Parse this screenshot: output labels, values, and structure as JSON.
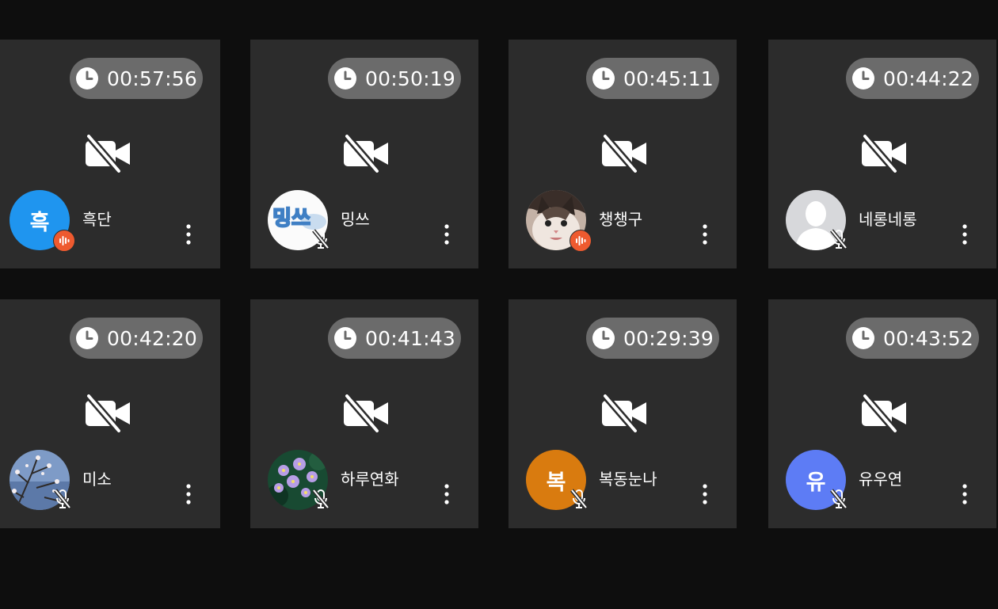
{
  "participants": [
    {
      "duration": "00:57:56",
      "name": "흑단",
      "avatar_type": "letter",
      "avatar_text": "흑",
      "avatar_color": "#1f95ef",
      "mic": "speaking"
    },
    {
      "duration": "00:50:19",
      "name": "밍쓰",
      "avatar_type": "image",
      "avatar_image": "handwritten-logo",
      "avatar_text": "밍쓰",
      "mic": "muted"
    },
    {
      "duration": "00:45:11",
      "name": "챙챙구",
      "avatar_type": "image",
      "avatar_image": "cat-photo",
      "mic": "speaking"
    },
    {
      "duration": "00:44:22",
      "name": "네롱네롱",
      "avatar_type": "image",
      "avatar_image": "default-person-silhouette",
      "mic": "muted"
    },
    {
      "duration": "00:42:20",
      "name": "미소",
      "avatar_type": "image",
      "avatar_image": "blossom-branches-photo",
      "mic": "muted"
    },
    {
      "duration": "00:41:43",
      "name": "하루연화",
      "avatar_type": "image",
      "avatar_image": "purple-flowers-photo",
      "mic": "muted"
    },
    {
      "duration": "00:29:39",
      "name": "복동눈나",
      "avatar_type": "letter",
      "avatar_text": "복",
      "avatar_color": "#d97b0f",
      "mic": "muted"
    },
    {
      "duration": "00:43:52",
      "name": "유우연",
      "avatar_type": "letter",
      "avatar_text": "유",
      "avatar_color": "#5d7cf5",
      "mic": "muted"
    }
  ],
  "icons": {
    "timer": "clock-icon",
    "video": "video-off-icon",
    "speaking": "audio-level-icon",
    "muted": "mic-off-icon",
    "menu": "more-vertical-icon"
  },
  "colors": {
    "background": "#0e0e0e",
    "tile": "#2c2c2c",
    "timer_pill": "#6b6b6b",
    "speaking_badge": "#ee5a2f"
  }
}
